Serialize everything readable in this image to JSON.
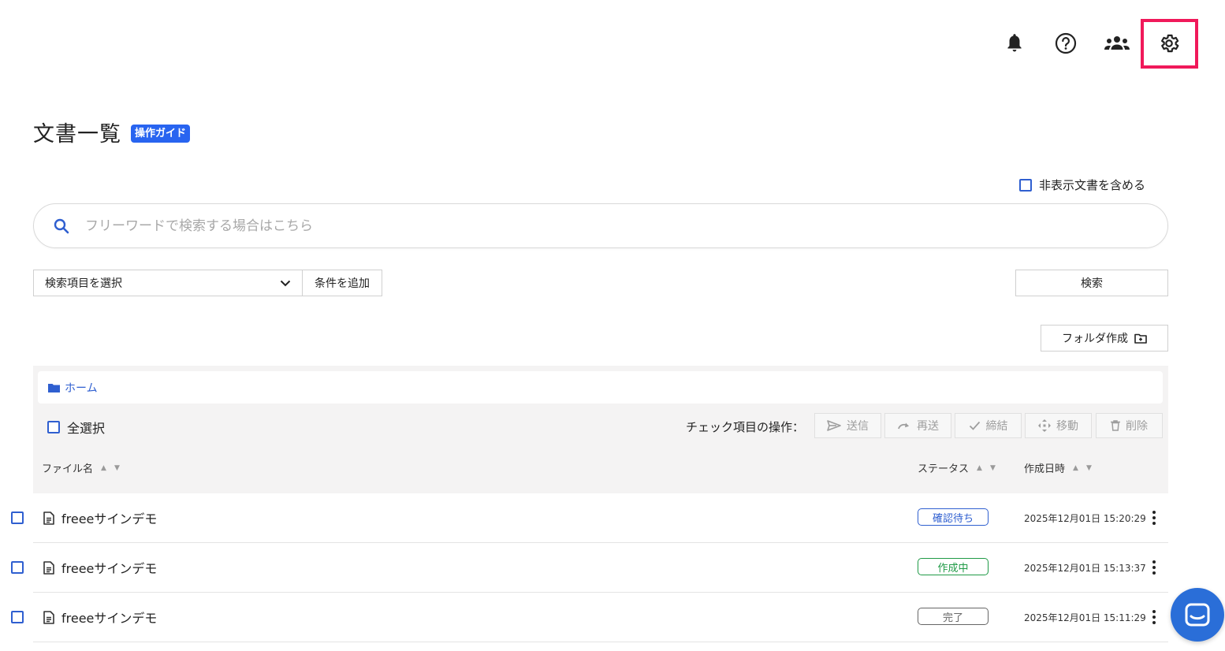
{
  "header": {
    "icons": [
      "bell-icon",
      "help-icon",
      "members-icon",
      "gear-icon"
    ],
    "highlight_color": "#f0195a"
  },
  "page": {
    "title": "文書一覧",
    "guide_badge": "操作ガイド",
    "include_hidden_label": "非表示文書を含める"
  },
  "search": {
    "placeholder": "フリーワードで検索する場合はこちら",
    "value": "",
    "field_select": "検索項目を選択",
    "add_condition": "条件を追加",
    "search_button": "検索",
    "create_folder": "フォルダ作成"
  },
  "list": {
    "breadcrumb": "ホーム",
    "select_all": "全選択",
    "bulk_label": "チェック項目の操作：",
    "bulk_actions": [
      {
        "label": "送信",
        "icon": "send-icon"
      },
      {
        "label": "再送",
        "icon": "redo-icon"
      },
      {
        "label": "締結",
        "icon": "check-icon"
      },
      {
        "label": "移動",
        "icon": "move-icon"
      },
      {
        "label": "削除",
        "icon": "trash-icon"
      }
    ],
    "columns": {
      "filename": "ファイル名",
      "status": "ステータス",
      "created": "作成日時"
    },
    "rows": [
      {
        "name": "freeeサインデモ",
        "status": "確認待ち",
        "status_color": "#2f5fd0",
        "created": "2025年12月01日 15:20:29"
      },
      {
        "name": "freeeサインデモ",
        "status": "作成中",
        "status_color": "#1f9a46",
        "created": "2025年12月01日 15:13:37"
      },
      {
        "name": "freeeサインデモ",
        "status": "完了",
        "status_color": "#666666",
        "created": "2025年12月01日 15:11:29"
      }
    ]
  },
  "accent_color": "#2864f0"
}
